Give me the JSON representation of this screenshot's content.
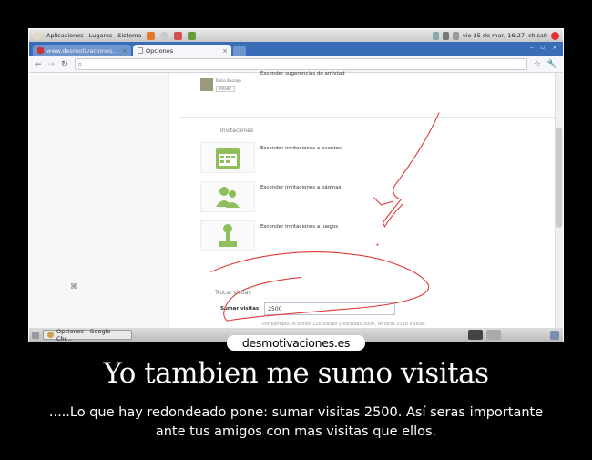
{
  "topPanel": {
    "menus": [
      "Aplicaciones",
      "Lugares",
      "Sistema"
    ],
    "clock": "vie 25 de mar, 16:27",
    "user": "chisa9"
  },
  "browser": {
    "tabs": [
      {
        "label": "www.desmotivaciones.."
      },
      {
        "label": "Opciones"
      }
    ],
    "omnibox": ""
  },
  "settings": {
    "partial_row": {
      "label": "Esconder sugerencias de amistad",
      "name": "Rocio Buscojo",
      "button": "Añadir"
    },
    "section_invitations": "Invitaciones",
    "rows": [
      {
        "label": "Esconder invitaciones a eventos",
        "icon": "calendar-icon"
      },
      {
        "label": "Esconder invitaciones a páginas",
        "icon": "people-icon"
      },
      {
        "label": "Esconder invitaciones a juegos",
        "icon": "joystick-icon"
      }
    ],
    "section_trick": "Trucar visitas",
    "visits_label": "Sumar visitas",
    "visits_value": "2500",
    "hint": "Por ejemplo, si tienes 120 visitas y escribes 3000, tendrás 3120 visitas."
  },
  "taskbar": {
    "window": "Opciones - Google Chr..."
  },
  "poster": {
    "logo": "desmotivaciones.es",
    "title": "Yo tambien me sumo visitas",
    "caption": ".....Lo que hay redondeado pone: sumar visitas 2500. Así seras importante ante tus amigos con mas visitas que ellos."
  },
  "colors": {
    "annotation": "#e03a3a",
    "tabstrip": "#3a6db8",
    "icon_green": "#8fbf5a"
  }
}
